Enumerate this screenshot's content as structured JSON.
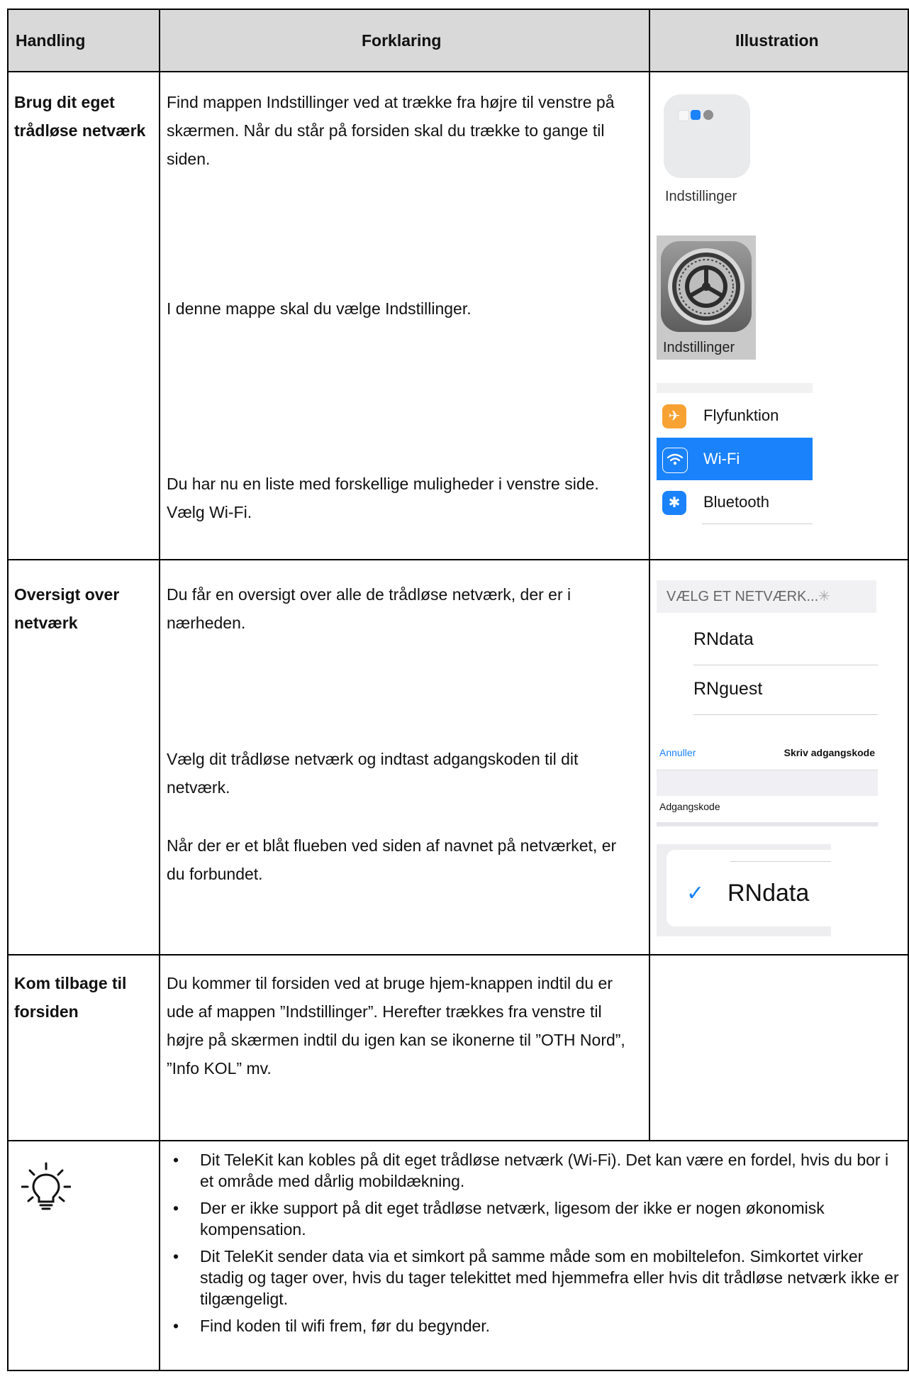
{
  "header": {
    "col1": "Handling",
    "col2": "Forklaring",
    "col3": "Illustration"
  },
  "rows": [
    {
      "label": "Brug dit eget trådløse netværk",
      "texts": [
        "Find mappen Indstillinger ved at trække fra højre til venstre på skærmen. Når du står på forsiden skal du trække to gange til siden.",
        "I denne mappe skal du vælge Indstillinger.",
        "Du har nu en liste med forskellige muligheder i venstre side. Vælg Wi-Fi."
      ]
    },
    {
      "label": "Oversigt over netværk",
      "texts": [
        "Du får en oversigt over alle de trådløse netværk, der er i nærheden.",
        "Vælg dit trådløse netværk og indtast adgangskoden til dit netværk.",
        "Når der er et blåt flueben ved siden af navnet på netværket, er du forbundet."
      ]
    },
    {
      "label": "Kom tilbage til forsiden",
      "texts": [
        "Du kommer til forsiden ved at bruge hjem-knappen indtil du er ude af mappen ”Indstillinger”. Herefter trækkes fra venstre til højre på skærmen indtil du igen kan se ikonerne til ”OTH Nord”, ”Info KOL” mv."
      ]
    }
  ],
  "illustrations": {
    "folder_caption": "Indstillinger",
    "settings_caption": "Indstillinger",
    "menu": [
      {
        "label": "Flyfunktion",
        "icon": "airplane-icon",
        "color": "#f7a233"
      },
      {
        "label": "Wi-Fi",
        "icon": "wifi-icon",
        "color": "#1a82fb",
        "selected": true
      },
      {
        "label": "Bluetooth",
        "icon": "bluetooth-icon",
        "color": "#1a82fb"
      }
    ],
    "network_header": "VÆLG ET NETVÆRK...",
    "networks": [
      "RNdata",
      "RNguest"
    ],
    "password_dialog": {
      "cancel": "Annuller",
      "title": "Skriv adgangskode",
      "field_label": "Adgangskode"
    },
    "connected_network": "RNdata"
  },
  "tips": {
    "icon": "lightbulb-icon",
    "items": [
      "Dit TeleKit kan kobles på dit eget trådløse netværk (Wi-Fi). Det kan være en fordel, hvis du bor i et område med dårlig mobildækning.",
      "Der er ikke support på dit eget trådløse netværk, ligesom der ikke er nogen økonomisk kompensation.",
      "Dit TeleKit sender data via et simkort på samme måde som en mobiltelefon. Simkortet virker stadig og tager over, hvis du tager telekittet med hjemmefra eller hvis dit trådløse netværk ikke er tilgængeligt.",
      "Find koden til wifi frem, før du begynder."
    ]
  },
  "colors": {
    "header_bg": "#d9d9d9",
    "accent_blue": "#1a82fb"
  }
}
